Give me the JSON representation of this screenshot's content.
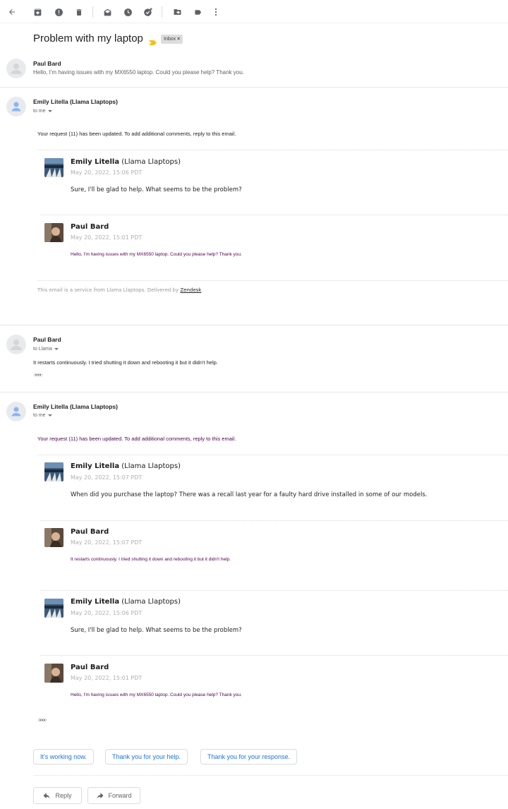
{
  "toolbar": {
    "icons": [
      "back-arrow-icon",
      "archive-icon",
      "report-spam-icon",
      "delete-icon",
      "mark-unread-icon",
      "snooze-icon",
      "add-task-icon",
      "move-to-icon",
      "label-icon",
      "more-vert-icon"
    ]
  },
  "thread": {
    "subject": "Problem with my laptop",
    "label": "Inbox",
    "label_remove": "×"
  },
  "messages": [
    {
      "sender": "Paul Bard",
      "snippet": "Hello, I'm having issues with my MX6550 laptop. Could you please help? Thank you."
    },
    {
      "sender": "Emily Litella (Llama Llaptops)",
      "to": "to me",
      "intro": "Your request (11) has been updated. To add additional comments, reply to this email.",
      "quoted": [
        {
          "name_bold": "Emily Litella",
          "name_rest": " (Llama Llaptops)",
          "date": "May 20, 2022, 15:06 PDT",
          "text": "Sure, I'll be glad to help. What seems to be the problem?"
        },
        {
          "name_bold": "Paul Bard",
          "name_rest": "",
          "date": "May 20, 2022, 15:01 PDT",
          "text": "Hello, I'm having issues with my MX6550 laptop. Could you please help? Thank you."
        }
      ],
      "footer_prefix": "This email is a service from Llama Llaptops. Delivered by ",
      "footer_link": "Zendesk"
    },
    {
      "sender": "Paul Bard",
      "to": "to Llama",
      "body": "It restarts continuously. I tried shutting it down and rebooting it but it didn't help."
    },
    {
      "sender": "Emily Litella (Llama Llaptops)",
      "to": "to me",
      "intro": "Your request (11) has been updated. To add additional comments, reply to this email.",
      "quoted": [
        {
          "name_bold": "Emily Litella",
          "name_rest": " (Llama Llaptops)",
          "date": "May 20, 2022, 15:07 PDT",
          "text": "When did you purchase the laptop? There was a recall last year for a faulty hard drive installed in some of our models."
        },
        {
          "name_bold": "Paul Bard",
          "name_rest": "",
          "date": "May 20, 2022, 15:07 PDT",
          "text": "It restarts continuously. I tried shutting it down and rebooting it but it didn't help."
        },
        {
          "name_bold": "Emily Litella",
          "name_rest": " (Llama Llaptops)",
          "date": "May 20, 2022, 15:06 PDT",
          "text": "Sure, I'll be glad to help. What seems to be the problem?"
        },
        {
          "name_bold": "Paul Bard",
          "name_rest": "",
          "date": "May 20, 2022, 15:01 PDT",
          "text": "Hello, I'm having issues with my MX6550 laptop. Could you please help? Thank you."
        }
      ]
    }
  ],
  "smart_replies": [
    "It's working now.",
    "Thank you for your help.",
    "Thank you for your response."
  ],
  "actions": {
    "reply": "Reply",
    "forward": "Forward"
  },
  "colors": {
    "accent": "#1a73e8",
    "quoted_text": "#500050",
    "important": "#f4c20d"
  }
}
